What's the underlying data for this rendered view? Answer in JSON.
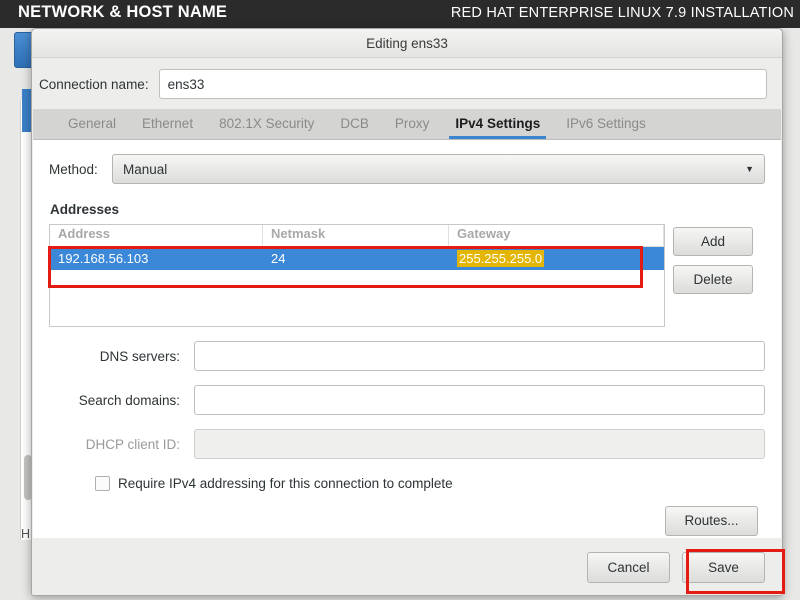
{
  "installer": {
    "header_left": "NETWORK & HOST NAME",
    "header_right": "RED HAT ENTERPRISE LINUX 7.9 INSTALLATION",
    "hostname_label_fragment": "H"
  },
  "dialog": {
    "title": "Editing ens33",
    "connection_name_label": "Connection name:",
    "connection_name_value": "ens33",
    "connection_name_placeholder": "",
    "tabs": [
      {
        "label": "General",
        "active": false
      },
      {
        "label": "Ethernet",
        "active": false
      },
      {
        "label": "802.1X Security",
        "active": false
      },
      {
        "label": "DCB",
        "active": false
      },
      {
        "label": "Proxy",
        "active": false
      },
      {
        "label": "IPv4 Settings",
        "active": true
      },
      {
        "label": "IPv6 Settings",
        "active": false
      }
    ],
    "method": {
      "label": "Method:",
      "value": "Manual",
      "caret": "▼"
    },
    "addresses": {
      "section_title": "Addresses",
      "columns": [
        "Address",
        "Netmask",
        "Gateway"
      ],
      "rows": [
        {
          "address": "192.168.56.103",
          "netmask": "24",
          "gateway": "255.255.255.0",
          "selected": true,
          "highlighted_cell": "gateway"
        }
      ],
      "add_label": "Add",
      "delete_label": "Delete"
    },
    "fields": [
      {
        "label": "DNS servers:",
        "value": "",
        "placeholder": "",
        "disabled": false
      },
      {
        "label": "Search domains:",
        "value": "",
        "placeholder": "",
        "disabled": false
      },
      {
        "label": "DHCP client ID:",
        "value": "",
        "placeholder": "",
        "disabled": true
      }
    ],
    "require_ipv4": {
      "label": "Require IPv4 addressing for this connection to complete",
      "checked": false
    },
    "routes_label": "Routes...",
    "cancel_label": "Cancel",
    "save_label": "Save"
  },
  "colors": {
    "header_bg": "#2b2b2b",
    "accent_blue": "#3b84d0",
    "row_selected": "#3b87d8",
    "cell_highlight": "#e3b505",
    "annotation_red": "#e41b13",
    "dialog_bg": "#ededec"
  }
}
